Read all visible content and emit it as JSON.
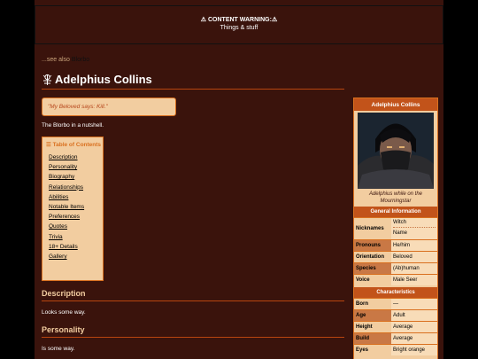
{
  "content_warning": {
    "title": "⚠ CONTENT WARNING:⚠",
    "subtitle": "Things & stuff"
  },
  "see_also": {
    "prefix": "...see also",
    "link": "Blorbo"
  },
  "page": {
    "title": "Adelphius Collins",
    "quote": "\"My Beloved says: Kill.\"",
    "nutshell": "The Blorbo in a nutshell."
  },
  "toc": {
    "title": "☰ Table of Contents",
    "items": [
      "Description",
      "Personality",
      "Biography",
      "Relationships",
      "Abilities",
      "Notable Items",
      "Preferences",
      "Quotes",
      "Trivia",
      "18+ Details",
      "Gallery"
    ]
  },
  "sections": [
    {
      "heading": "Description",
      "text": "Looks some way."
    },
    {
      "heading": "Personality",
      "text": "Is some way."
    }
  ],
  "infobox": {
    "title": "Adelphius Collins",
    "caption": "Adelphius while on the Mourningstar",
    "general_header": "General Information",
    "general": [
      {
        "key": "Nicknames",
        "value": "Witch",
        "value2": "Name"
      },
      {
        "key": "Pronouns",
        "value": "He/him"
      },
      {
        "key": "Orientation",
        "value": "Beloved"
      },
      {
        "key": "Species",
        "value": "(Ab)human"
      },
      {
        "key": "Voice",
        "value": "Male Seer"
      }
    ],
    "char_header": "Characteristics",
    "characteristics": [
      {
        "key": "Born",
        "value": "—"
      },
      {
        "key": "Age",
        "value": "Adult"
      },
      {
        "key": "Height",
        "value": "Average"
      },
      {
        "key": "Build",
        "value": "Average"
      },
      {
        "key": "Eyes",
        "value": "Bright orange"
      }
    ]
  }
}
